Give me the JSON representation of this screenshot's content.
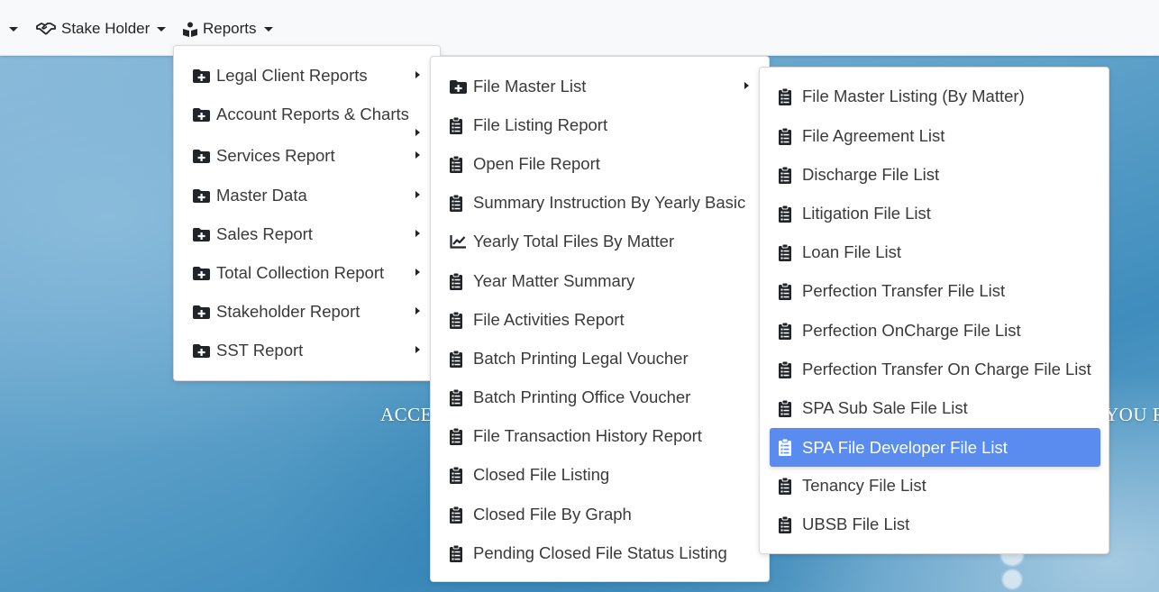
{
  "navbar": {
    "stakeholder_label": "Stake Holder",
    "reports_label": "Reports"
  },
  "hero": {
    "text_left": "ACCE",
    "text_right": "YOU FI"
  },
  "reports_menu": {
    "items": [
      {
        "label": "Legal Client Reports",
        "icon": "folder-plus-icon",
        "submenu": true
      },
      {
        "label": "Account Reports & Charts",
        "icon": "folder-plus-icon",
        "submenu": true
      },
      {
        "label": "Services Report",
        "icon": "folder-plus-icon",
        "submenu": true
      },
      {
        "label": "Master Data",
        "icon": "folder-plus-icon",
        "submenu": true
      },
      {
        "label": "Sales Report",
        "icon": "folder-plus-icon",
        "submenu": true
      },
      {
        "label": "Total Collection Report",
        "icon": "folder-plus-icon",
        "submenu": true
      },
      {
        "label": "Stakeholder Report",
        "icon": "folder-plus-icon",
        "submenu": true
      },
      {
        "label": "SST Report",
        "icon": "folder-plus-icon",
        "submenu": true
      }
    ]
  },
  "legal_client_menu": {
    "items": [
      {
        "label": "File Master List",
        "icon": "folder-plus-icon",
        "submenu": true
      },
      {
        "label": "File Listing Report",
        "icon": "clipboard-list-icon"
      },
      {
        "label": "Open File Report",
        "icon": "clipboard-list-icon"
      },
      {
        "label": "Summary Instruction By Yearly Basic",
        "icon": "clipboard-list-icon"
      },
      {
        "label": "Yearly Total Files By Matter",
        "icon": "line-chart-icon"
      },
      {
        "label": "Year Matter Summary",
        "icon": "clipboard-list-icon"
      },
      {
        "label": "File Activities Report",
        "icon": "clipboard-list-icon"
      },
      {
        "label": "Batch Printing Legal Voucher",
        "icon": "clipboard-list-icon"
      },
      {
        "label": "Batch Printing Office Voucher",
        "icon": "clipboard-list-icon"
      },
      {
        "label": "File Transaction History Report",
        "icon": "clipboard-list-icon"
      },
      {
        "label": "Closed File Listing",
        "icon": "clipboard-list-icon"
      },
      {
        "label": "Closed File By Graph",
        "icon": "clipboard-list-icon"
      },
      {
        "label": "Pending Closed File Status Listing",
        "icon": "clipboard-list-icon"
      }
    ]
  },
  "file_master_menu": {
    "items": [
      {
        "label": "File Master Listing (By Matter)",
        "icon": "clipboard-list-icon"
      },
      {
        "label": "File Agreement List",
        "icon": "clipboard-list-icon"
      },
      {
        "label": "Discharge File List",
        "icon": "clipboard-list-icon"
      },
      {
        "label": "Litigation File List",
        "icon": "clipboard-list-icon"
      },
      {
        "label": "Loan File List",
        "icon": "clipboard-list-icon"
      },
      {
        "label": "Perfection Transfer File List",
        "icon": "clipboard-list-icon"
      },
      {
        "label": "Perfection OnCharge File List",
        "icon": "clipboard-list-icon"
      },
      {
        "label": "Perfection Transfer On Charge File List",
        "icon": "clipboard-list-icon"
      },
      {
        "label": "SPA Sub Sale File List",
        "icon": "clipboard-list-icon"
      },
      {
        "label": "SPA File Developer File List",
        "icon": "clipboard-list-icon",
        "active": true
      },
      {
        "label": "Tenancy File List",
        "icon": "clipboard-list-icon"
      },
      {
        "label": "UBSB File List",
        "icon": "clipboard-list-icon"
      }
    ]
  },
  "colors": {
    "active_item_bg": "#5a8cf0",
    "navbar_bg": "#f8f9fa",
    "menu_text": "#3a3a3a"
  }
}
